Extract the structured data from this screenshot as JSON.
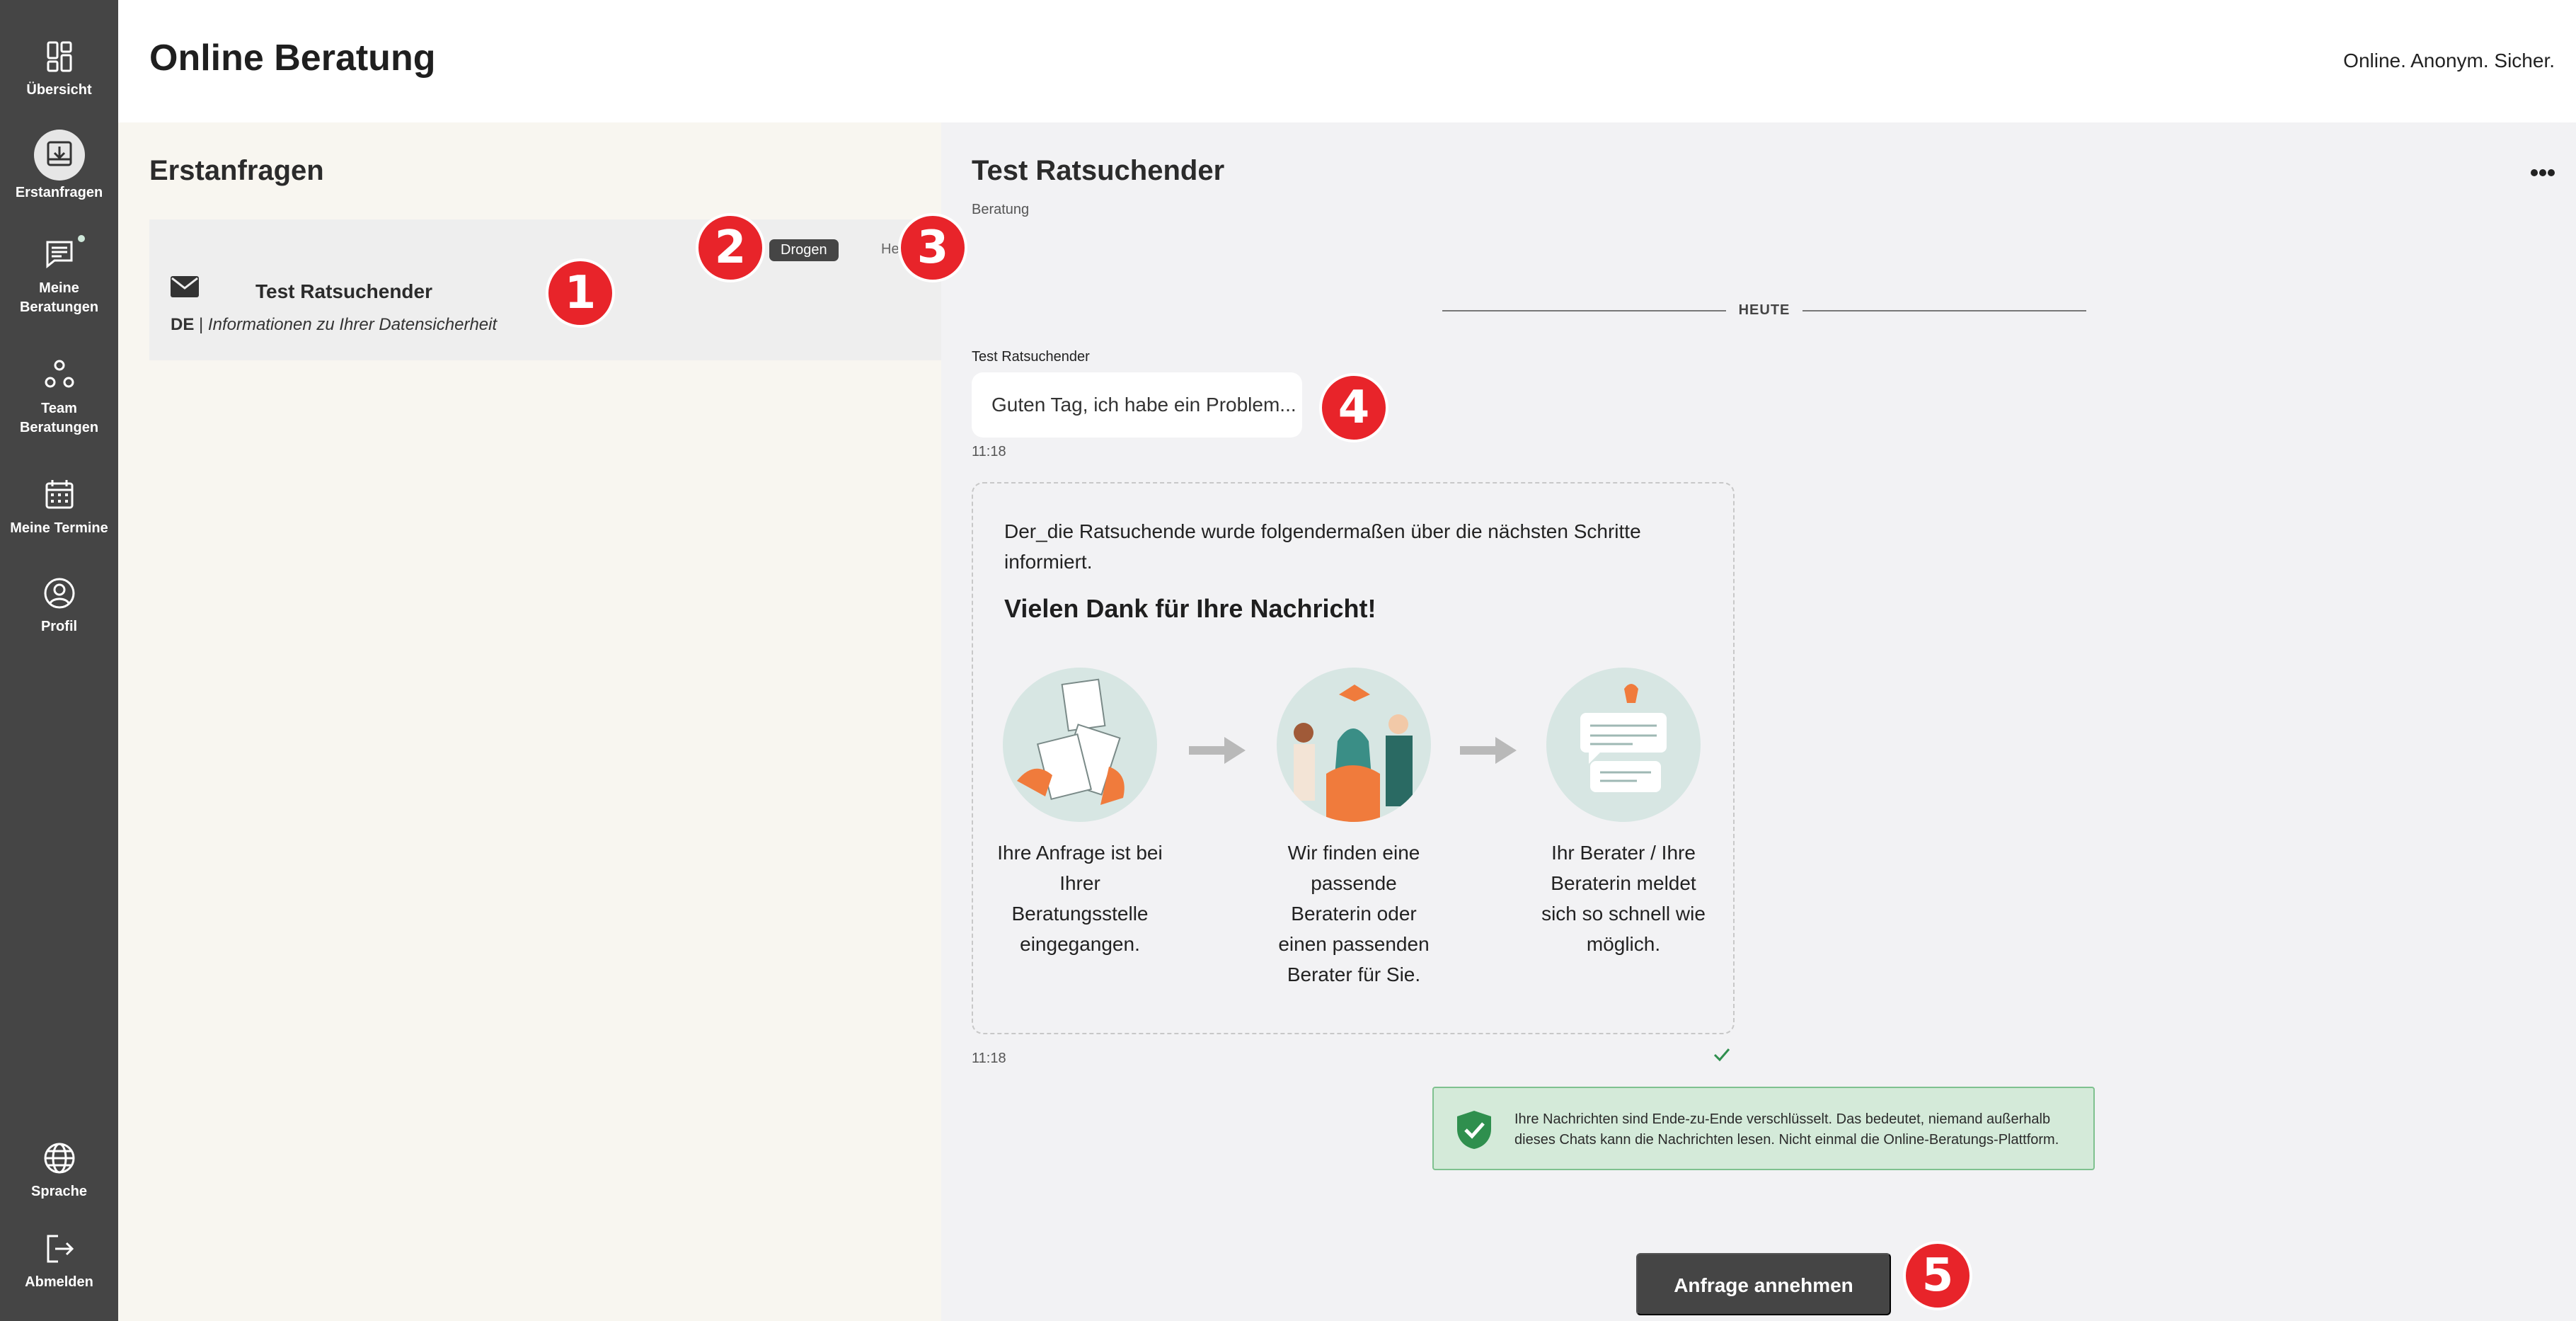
{
  "header": {
    "title": "Online Beratung",
    "tagline": "Online. Anonym. Sicher."
  },
  "nav": {
    "items": [
      {
        "label": "Übersicht",
        "icon": "dashboard-icon"
      },
      {
        "label": "Erstanfragen",
        "icon": "inbox-download-icon",
        "active": true
      },
      {
        "label": "Meine\nBeratungen",
        "icon": "chat-lines-icon",
        "badge": true
      },
      {
        "label": "Team\nBeratungen",
        "icon": "team-nodes-icon"
      },
      {
        "label": "Meine Termine",
        "icon": "calendar-icon"
      },
      {
        "label": "Profil",
        "icon": "user-circle-icon"
      }
    ],
    "bottom": [
      {
        "label": "Sprache",
        "icon": "globe-icon"
      },
      {
        "label": "Abmelden",
        "icon": "logout-icon"
      }
    ]
  },
  "list": {
    "title": "Erstanfragen",
    "items": [
      {
        "name": "Test Ratsuchender",
        "lang": "DE",
        "separator": "|",
        "subject": "Informationen zu Ihrer Datensicherheit",
        "topic": "Drogen",
        "date": "Heute",
        "icon": "envelope-icon"
      }
    ]
  },
  "chat": {
    "title": "Test Ratsuchender",
    "subtitle": "Beratung",
    "divider_label": "HEUTE",
    "message": {
      "sender": "Test Ratsuchender",
      "text": "Guten Tag, ich habe ein Problem...",
      "time": "11:18"
    },
    "info": {
      "intro": "Der_die Ratsuchende wurde folgendermaßen über die nächsten Schritte informiert.",
      "heading": "Vielen Dank für Ihre Nachricht!",
      "steps": [
        "Ihre Anfrage ist bei Ihrer Beratungsstelle eingegangen.",
        "Wir finden eine passende Beraterin oder einen passenden Berater für Sie.",
        "Ihr Berater / Ihre Beraterin meldet sich so schnell wie möglich."
      ],
      "time": "11:18"
    },
    "e2e_notice": "Ihre Nachrichten sind Ende-zu-Ende verschlüsselt. Das bedeutet, niemand außerhalb dieses Chats kann die Nachrichten lesen. Nicht einmal die Online-Beratungs-Plattform.",
    "accept_button": "Anfrage annehmen"
  },
  "markers": [
    "1",
    "2",
    "3",
    "4",
    "5"
  ],
  "colors": {
    "nav_bg": "#454545",
    "list_bg": "#f8f6f0",
    "chat_bg": "#f2f2f4",
    "marker": "#e8242a",
    "e2e_bg": "#d4ead9",
    "e2e_border": "#7fc18f",
    "shield": "#2f8f4e"
  }
}
